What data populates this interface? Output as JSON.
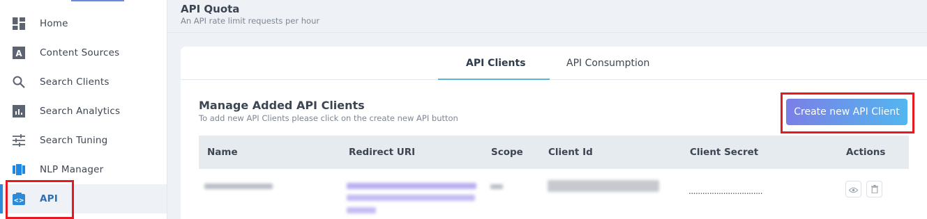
{
  "sidebar": {
    "items": [
      {
        "label": "Home",
        "icon": "dashboard-icon"
      },
      {
        "label": "Content Sources",
        "icon": "content-sources-icon"
      },
      {
        "label": "Search Clients",
        "icon": "search-icon"
      },
      {
        "label": "Search Analytics",
        "icon": "analytics-icon"
      },
      {
        "label": "Search Tuning",
        "icon": "tuning-sliders-icon"
      },
      {
        "label": "NLP Manager",
        "icon": "nlp-icon"
      },
      {
        "label": "API",
        "icon": "api-icon",
        "active": true
      }
    ]
  },
  "header": {
    "title": "API Quota",
    "subtitle": "An API rate limit requests per hour"
  },
  "tabs": [
    {
      "label": "API Clients",
      "active": true
    },
    {
      "label": "API Consumption",
      "active": false
    }
  ],
  "section": {
    "title": "Manage Added API Clients",
    "subtitle": "To add new API Clients please click on the create new API button",
    "create_button": "Create new API Client"
  },
  "table": {
    "columns": [
      "Name",
      "Redirect URI",
      "Scope",
      "Client Id",
      "Client Secret",
      "Actions"
    ],
    "rows": [
      {
        "secret": "................................",
        "actions": [
          "view-icon",
          "delete-icon"
        ]
      }
    ]
  },
  "colors": {
    "accent": "#2d8ad9",
    "highlight": "#e5191f",
    "button_gradient_start": "#7b7fe6",
    "button_gradient_end": "#53b6f0",
    "tab_underline": "#55b7d6"
  }
}
